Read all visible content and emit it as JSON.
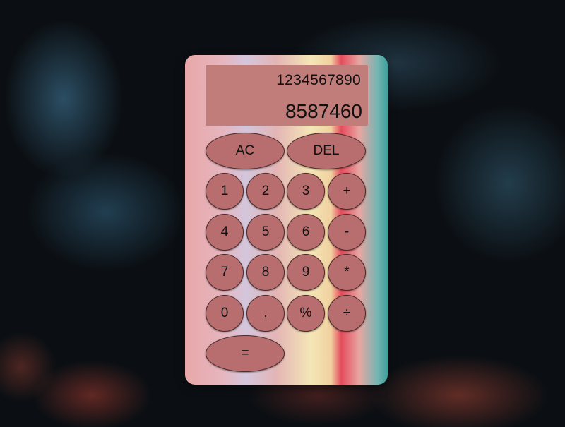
{
  "display": {
    "previous_operand": "1234567890",
    "current_operand": "8587460"
  },
  "buttons": {
    "all_clear": "AC",
    "delete": "DEL",
    "one": "1",
    "two": "2",
    "three": "3",
    "plus": "+",
    "four": "4",
    "five": "5",
    "six": "6",
    "minus": "-",
    "seven": "7",
    "eight": "8",
    "nine": "9",
    "multiply": "*",
    "zero": "0",
    "decimal": ".",
    "percent": "%",
    "divide": "÷",
    "equals": "="
  },
  "colors": {
    "button_fill": "#b86e6e",
    "display_fill": "#c07d7a"
  }
}
